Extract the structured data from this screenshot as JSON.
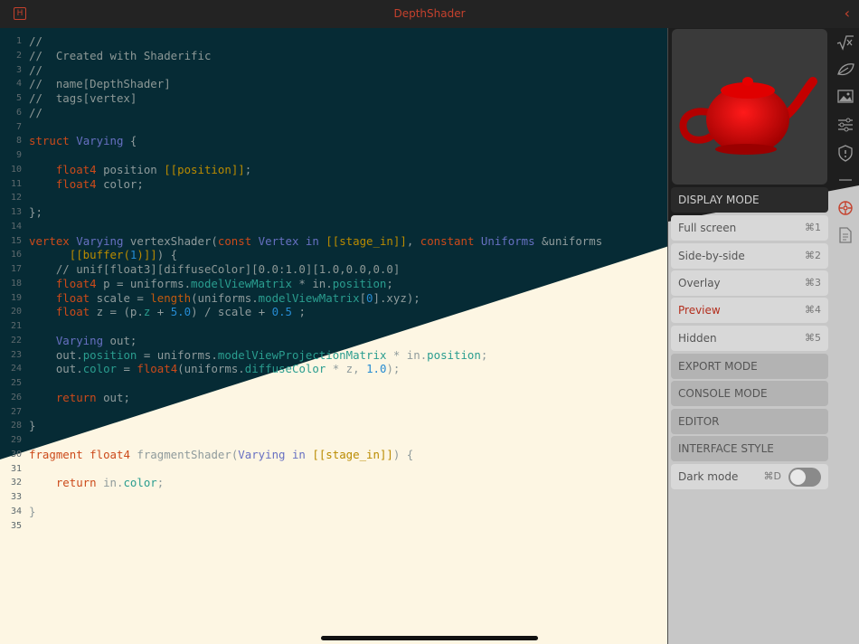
{
  "app": {
    "title": "DepthShader",
    "logo_letter": "H",
    "back_icon": "chevron-left-icon",
    "accent": "#c5412d"
  },
  "code": {
    "line_numbers": [
      "1",
      "2",
      "3",
      "4",
      "5",
      "6",
      "7",
      "8",
      "9",
      "10",
      "11",
      "12",
      "13",
      "14",
      "15",
      "16",
      "17",
      "18",
      "19",
      "20",
      "21",
      "22",
      "23",
      "24",
      "25",
      "26",
      "27",
      "28",
      "29",
      "30",
      "31",
      "32",
      "33",
      "34",
      "35"
    ],
    "lines": [
      [
        [
          "c",
          "//"
        ]
      ],
      [
        [
          "c",
          "//  Created with Shaderific"
        ]
      ],
      [
        [
          "c",
          "//"
        ]
      ],
      [
        [
          "c",
          "//  name[DepthShader]"
        ]
      ],
      [
        [
          "c",
          "//  tags[vertex]"
        ]
      ],
      [
        [
          "c",
          "//"
        ]
      ],
      [],
      [
        [
          "k",
          "struct"
        ],
        [
          "t",
          " "
        ],
        [
          "s",
          "Varying"
        ],
        [
          "t",
          " {"
        ]
      ],
      [],
      [
        [
          "t",
          "    "
        ],
        [
          "k",
          "float4"
        ],
        [
          "t",
          " position "
        ],
        [
          "f",
          "[[position]]"
        ],
        [
          "t",
          ";"
        ]
      ],
      [
        [
          "t",
          "    "
        ],
        [
          "k",
          "float4"
        ],
        [
          "t",
          " color;"
        ]
      ],
      [],
      [
        [
          "t",
          "};"
        ]
      ],
      [],
      [
        [
          "k",
          "vertex"
        ],
        [
          "t",
          " "
        ],
        [
          "s",
          "Varying"
        ],
        [
          "t",
          " vertexShader("
        ],
        [
          "k",
          "const"
        ],
        [
          "t",
          " "
        ],
        [
          "s",
          "Vertex"
        ],
        [
          "t",
          " "
        ],
        [
          "s",
          "in"
        ],
        [
          "t",
          " "
        ],
        [
          "f",
          "[[stage_in]]"
        ],
        [
          "t",
          ", "
        ],
        [
          "k",
          "constant"
        ],
        [
          "t",
          " "
        ],
        [
          "s",
          "Uniforms"
        ],
        [
          "t",
          " &uniforms"
        ]
      ],
      [
        [
          "t",
          "      "
        ],
        [
          "f",
          "[[buffer("
        ],
        [
          "n",
          "1"
        ],
        [
          "f",
          ")]]"
        ],
        [
          "t",
          ") {"
        ]
      ],
      [
        [
          "t",
          "    "
        ],
        [
          "c",
          "// unif[float3][diffuseColor][0.0:1.0][1.0,0.0,0.0]"
        ]
      ],
      [
        [
          "t",
          "    "
        ],
        [
          "k",
          "float4"
        ],
        [
          "t",
          " p = uniforms."
        ],
        [
          "m",
          "modelViewMatrix"
        ],
        [
          "t",
          " * in."
        ],
        [
          "m",
          "position"
        ],
        [
          "t",
          ";"
        ]
      ],
      [
        [
          "t",
          "    "
        ],
        [
          "k",
          "float"
        ],
        [
          "t",
          " scale = "
        ],
        [
          "p",
          "length"
        ],
        [
          "t",
          "(uniforms."
        ],
        [
          "m",
          "modelViewMatrix"
        ],
        [
          "t",
          "["
        ],
        [
          "n",
          "0"
        ],
        [
          "t",
          "].xyz);"
        ]
      ],
      [
        [
          "t",
          "    "
        ],
        [
          "k",
          "float"
        ],
        [
          "t",
          " z = (p."
        ],
        [
          "m",
          "z"
        ],
        [
          "t",
          " + "
        ],
        [
          "n",
          "5.0"
        ],
        [
          "t",
          ") / scale + "
        ],
        [
          "n",
          "0.5"
        ],
        [
          "t",
          " ;"
        ]
      ],
      [],
      [
        [
          "t",
          "    "
        ],
        [
          "s",
          "Varying"
        ],
        [
          "t",
          " out;"
        ]
      ],
      [
        [
          "t",
          "    out."
        ],
        [
          "m",
          "position"
        ],
        [
          "t",
          " = uniforms."
        ],
        [
          "m",
          "modelViewProjectionMatrix"
        ],
        [
          "t",
          " * in."
        ],
        [
          "m",
          "position"
        ],
        [
          "t",
          ";"
        ]
      ],
      [
        [
          "t",
          "    out."
        ],
        [
          "m",
          "color"
        ],
        [
          "t",
          " = "
        ],
        [
          "k",
          "float4"
        ],
        [
          "t",
          "(uniforms."
        ],
        [
          "m",
          "diffuseColor"
        ],
        [
          "t",
          " * z, "
        ],
        [
          "n",
          "1.0"
        ],
        [
          "t",
          ");"
        ]
      ],
      [],
      [
        [
          "t",
          "    "
        ],
        [
          "k",
          "return"
        ],
        [
          "t",
          " out;"
        ]
      ],
      [],
      [
        [
          "t",
          "}"
        ]
      ],
      [],
      [
        [
          "k",
          "fragment"
        ],
        [
          "t",
          " "
        ],
        [
          "k",
          "float4"
        ],
        [
          "t",
          " fragmentShader("
        ],
        [
          "s",
          "Varying"
        ],
        [
          "t",
          " "
        ],
        [
          "s",
          "in"
        ],
        [
          "t",
          " "
        ],
        [
          "f",
          "[[stage_in]]"
        ],
        [
          "t",
          ") {"
        ]
      ],
      [],
      [
        [
          "t",
          "    "
        ],
        [
          "k",
          "return"
        ],
        [
          "t",
          " in."
        ],
        [
          "m",
          "color"
        ],
        [
          "t",
          ";"
        ]
      ],
      [],
      [
        [
          "t",
          "}"
        ]
      ],
      []
    ]
  },
  "panel": {
    "display_mode": "DISPLAY MODE",
    "options": [
      {
        "label": "Full screen",
        "shortcut": "⌘1"
      },
      {
        "label": "Side-by-side",
        "shortcut": "⌘2"
      },
      {
        "label": "Overlay",
        "shortcut": "⌘3"
      },
      {
        "label": "Preview",
        "shortcut": "⌘4"
      },
      {
        "label": "Hidden",
        "shortcut": "⌘5"
      }
    ],
    "export_mode": "EXPORT MODE",
    "console_mode": "CONSOLE MODE",
    "editor": "EDITOR",
    "interface_style": "INTERFACE STYLE",
    "dark_mode": {
      "label": "Dark mode",
      "shortcut": "⌘D"
    }
  },
  "toolbar": {
    "icons": [
      "sqrt-icon",
      "leaf-icon",
      "image-icon",
      "sliders-icon",
      "shield-icon",
      "settings-icon",
      "document-icon"
    ]
  },
  "colors": {
    "dark_bg": "#062b35",
    "light_bg": "#fdf6e3",
    "teapot": "#d40000"
  }
}
